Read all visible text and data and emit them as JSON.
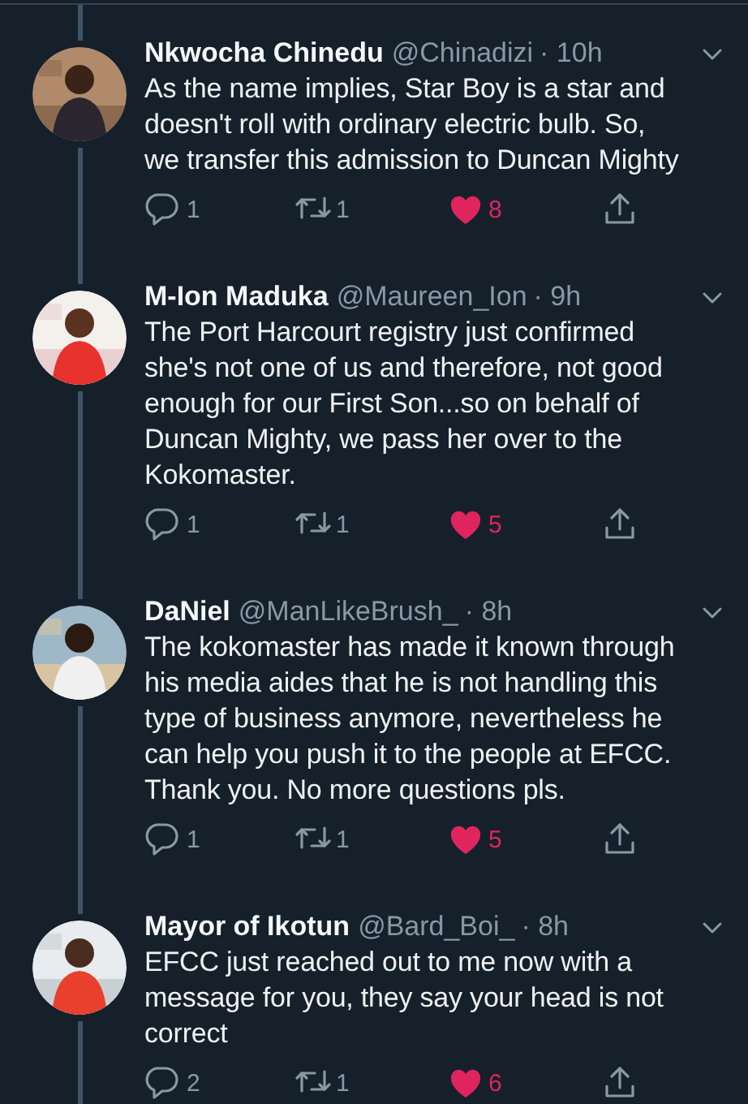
{
  "tweets": [
    {
      "name": "Nkwocha Chinedu",
      "handle": "@Chinadizi",
      "time": "· 10h",
      "text": "As the name implies, Star Boy is a star and\ndoesn't roll with ordinary electric bulb. So,\nwe transfer this admission to Duncan Mighty",
      "replies": "1",
      "retweets": "1",
      "likes": "8",
      "liked": true
    },
    {
      "name": "M-Ion Maduka",
      "handle": "@Maureen_Ion",
      "time": "· 9h",
      "text": "The Port Harcourt registry just confirmed\nshe's not one of us and therefore, not good\nenough for our First Son...so on behalf of\nDuncan Mighty, we pass her over to the\nKokomaster.",
      "replies": "1",
      "retweets": "1",
      "likes": "5",
      "liked": true
    },
    {
      "name": "DaNiel",
      "handle": "@ManLikeBrush_",
      "time": "· 8h",
      "text": "The kokomaster has made it known through\nhis media aides that he is not handling this\ntype of business anymore, nevertheless he\ncan help you push it to the people at EFCC.\nThank you. No more questions pls.",
      "replies": "1",
      "retweets": "1",
      "likes": "5",
      "liked": true
    },
    {
      "name": "Mayor of Ikotun",
      "handle": "@Bard_Boi_",
      "time": "· 8h",
      "text": "EFCC just reached out to me now with a\nmessage for you, they say your head is not\ncorrect",
      "replies": "2",
      "retweets": "1",
      "likes": "6",
      "liked": true
    }
  ]
}
